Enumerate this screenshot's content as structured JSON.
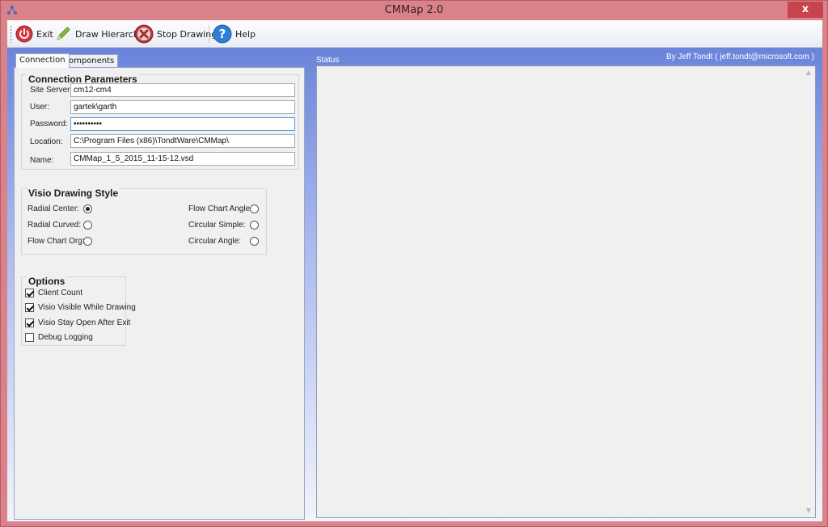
{
  "window": {
    "title": "CMMap 2.0",
    "close_glyph": "x"
  },
  "toolbar": {
    "exit_label": "Exit",
    "draw_label": "Draw Hierarchy",
    "stop_label": "Stop Drawing",
    "help_label": "Help"
  },
  "tabs": [
    {
      "label": "Connection",
      "active": true
    },
    {
      "label": "Components",
      "active": false
    }
  ],
  "connection": {
    "title": "Connection Parameters",
    "fields": [
      {
        "label": "Site Server:",
        "value": "cm12-cm4"
      },
      {
        "label": "User:",
        "value": "gartek\\garth"
      },
      {
        "label": "Password:",
        "value": "••••••••••"
      },
      {
        "label": "Location:",
        "value": "C:\\Program Files (x86)\\TondtWare\\CMMap\\"
      },
      {
        "label": "Name:",
        "value": "CMMap_1_5_2015_11-15-12.vsd"
      }
    ]
  },
  "style": {
    "title": "Visio Drawing Style",
    "options": [
      {
        "label": "Radial Center:",
        "checked": true
      },
      {
        "label": "Radial Curved:",
        "checked": false
      },
      {
        "label": "Flow Chart Org:",
        "checked": false
      },
      {
        "label": "Flow Chart Angle:",
        "checked": false
      },
      {
        "label": "Circular Simple:",
        "checked": false
      },
      {
        "label": "Circular Angle:",
        "checked": false
      }
    ]
  },
  "options": {
    "title": "Options",
    "items": [
      {
        "label": "Client Count",
        "checked": true
      },
      {
        "label": "Visio Visible While Drawing",
        "checked": true
      },
      {
        "label": "Visio Stay Open After Exit",
        "checked": true
      },
      {
        "label": "Debug Logging",
        "checked": false
      }
    ]
  },
  "status": {
    "label": "Status",
    "author": "By Jeff Tondt ( jeff.tondt@microsoft.com )"
  },
  "colors": {
    "title_bar": "#d9828a",
    "close_button": "#c7434d",
    "client_blue": "#6f86d8"
  },
  "icons": {
    "exit": "power-icon",
    "draw": "pencil-icon",
    "stop": "stop-x-icon",
    "help": "help-question-icon"
  }
}
